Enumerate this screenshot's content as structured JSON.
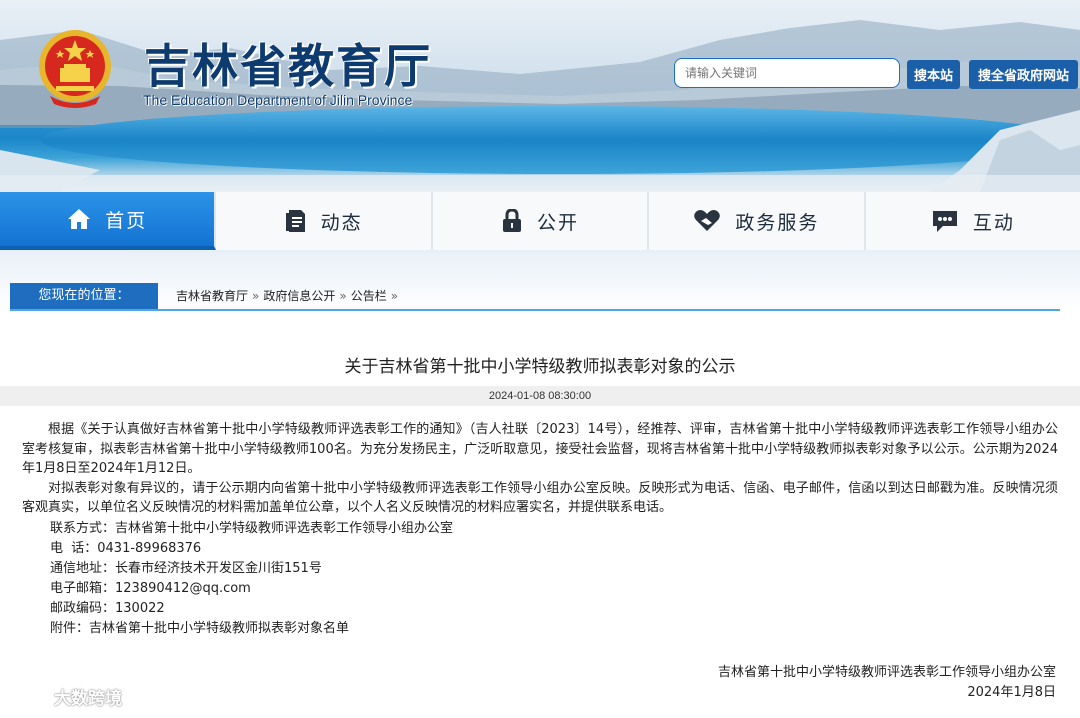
{
  "header": {
    "title": "吉林省教育厅",
    "subtitle": "The Education Department of Jilin Province",
    "search_placeholder": "请输入关键词",
    "search_site_label": "搜本站",
    "search_gov_label": "搜全省政府网站"
  },
  "nav": {
    "items": [
      {
        "label": "首页",
        "icon": "home-icon",
        "active": true
      },
      {
        "label": "动态",
        "icon": "document-icon",
        "active": false
      },
      {
        "label": "公开",
        "icon": "lock-icon",
        "active": false
      },
      {
        "label": "政务服务",
        "icon": "heart-hand-icon",
        "active": false
      },
      {
        "label": "互动",
        "icon": "chat-icon",
        "active": false
      }
    ]
  },
  "breadcrumb": {
    "label": "您现在的位置：",
    "items": [
      "吉林省教育厅",
      "政府信息公开",
      "公告栏"
    ],
    "separator": "»"
  },
  "article": {
    "title": "关于吉林省第十批中小学特级教师拟表彰对象的公示",
    "date": "2024-01-08 08:30:00",
    "paragraphs": [
      "根据《关于认真做好吉林省第十批中小学特级教师评选表彰工作的通知》（吉人社联〔2023〕14号），经推荐、评审，吉林省第十批中小学特级教师评选表彰工作领导小组办公室考核复审，拟表彰吉林省第十批中小学特级教师100名。为充分发扬民主，广泛听取意见，接受社会监督，现将吉林省第十批中小学特级教师拟表彰对象予以公示。公示期为2024年1月8日至2024年1月12日。",
      "对拟表彰对象有异议的，请于公示期内向省第十批中小学特级教师评选表彰工作领导小组办公室反映。反映形式为电话、信函、电子邮件，信函以到达日邮戳为准。反映情况须客观真实，以单位名义反映情况的材料需加盖单位公章，以个人名义反映情况的材料应署实名，并提供联系电话。"
    ],
    "contact": [
      "联系方式：吉林省第十批中小学特级教师评选表彰工作领导小组办公室",
      "电  话：0431-89968376",
      "通信地址：长春市经济技术开发区金川街151号",
      "电子邮箱：123890412@qq.com",
      "邮政编码：130022",
      "附件：吉林省第十批中小学特级教师拟表彰对象名单"
    ],
    "signature_org": "吉林省第十批中小学特级教师评选表彰工作领导小组办公室",
    "signature_date": "2024年1月8日"
  },
  "watermark": "大数跨境",
  "colors": {
    "brand_blue": "#1b5fa8",
    "nav_active": "#1473d2",
    "breadcrumb_blue": "#1f6dbf",
    "title_navy": "#0d3b6f"
  }
}
